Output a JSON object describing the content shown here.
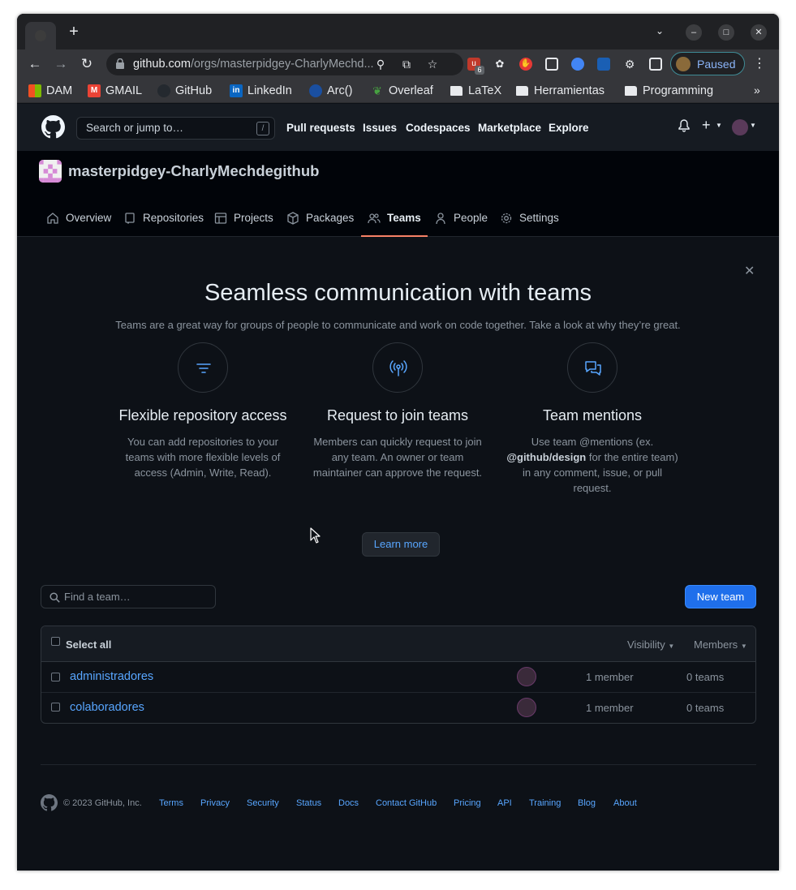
{
  "browser": {
    "url_domain": "github.com",
    "url_path": "/orgs/masterpidgey-CharlyMechd...",
    "extension_badge": "6",
    "profile_status": "Paused",
    "bookmarks": [
      "DAM",
      "GMAIL",
      "GitHub",
      "LinkedIn",
      "Arc()",
      "Overleaf",
      "LaTeX",
      "Herramientas",
      "Programming"
    ],
    "bookmark_more": "»"
  },
  "github_header": {
    "search_placeholder": "Search or jump to…",
    "search_shortcut": "/",
    "nav": [
      "Pull requests",
      "Issues",
      "Codespaces",
      "Marketplace",
      "Explore"
    ]
  },
  "org": {
    "name": "masterpidgey-CharlyMechdegithub",
    "tabs": [
      "Overview",
      "Repositories",
      "Projects",
      "Packages",
      "Teams",
      "People",
      "Settings"
    ],
    "active_tab": "Teams"
  },
  "banner": {
    "title": "Seamless communication with teams",
    "subtitle": "Teams are a great way for groups of people to communicate and work on code together. Take a look at why they’re great.",
    "features": [
      {
        "title": "Flexible repository access",
        "text": "You can add repositories to your teams with more flexible levels of access (Admin, Write, Read)."
      },
      {
        "title": "Request to join teams",
        "text": "Members can quickly request to join any team. An owner or team maintainer can approve the request."
      },
      {
        "title": "Team mentions",
        "text_before": "Use team @mentions (ex.",
        "text_bold": "@github/design",
        "text_after": "for the entire team) in any comment, issue, or pull request."
      }
    ],
    "learn_more": "Learn more"
  },
  "teams": {
    "find_placeholder": "Find a team…",
    "new_team": "New team",
    "select_all": "Select all",
    "visibility": "Visibility",
    "members": "Members",
    "rows": [
      {
        "name": "administradores",
        "members": "1 member",
        "teams": "0 teams"
      },
      {
        "name": "colaboradores",
        "members": "1 member",
        "teams": "0 teams"
      }
    ]
  },
  "footer": {
    "copyright": "© 2023 GitHub, Inc.",
    "links": [
      "Terms",
      "Privacy",
      "Security",
      "Status",
      "Docs",
      "Contact GitHub",
      "Pricing",
      "API",
      "Training",
      "Blog",
      "About"
    ]
  },
  "colors": {
    "accent": "#58a6ff",
    "primary_button": "#1f6feb",
    "active_tab_underline": "#f78166",
    "background": "#0d1117"
  }
}
